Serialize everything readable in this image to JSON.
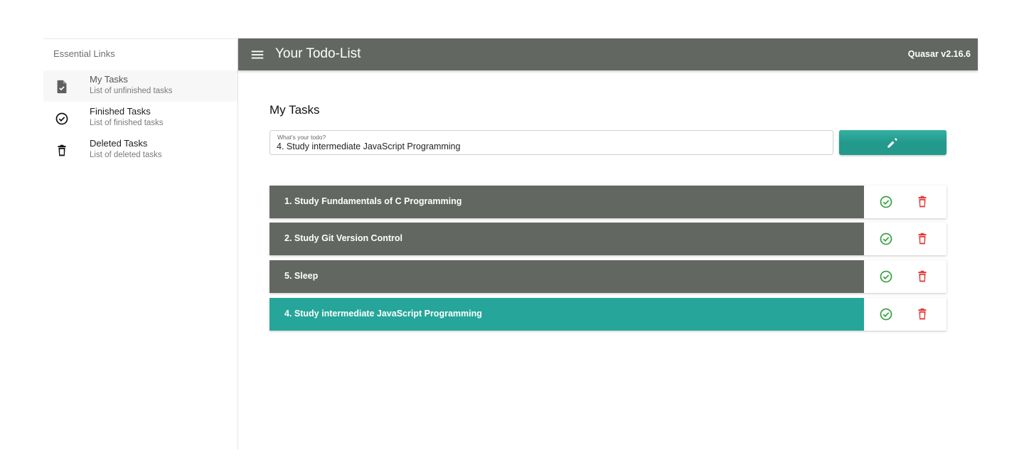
{
  "drawer": {
    "header": "Essential Links",
    "items": [
      {
        "title": "My Tasks",
        "caption": "List of unfinished tasks",
        "icon": "task-doc-icon"
      },
      {
        "title": "Finished Tasks",
        "caption": "List of finished tasks",
        "icon": "check-circle-icon"
      },
      {
        "title": "Deleted Tasks",
        "caption": "List of deleted tasks",
        "icon": "trash-icon"
      }
    ]
  },
  "header": {
    "title": "Your Todo-List",
    "version": "Quasar v2.16.6",
    "menu_icon": "menu-icon"
  },
  "main": {
    "title": "My Tasks",
    "input": {
      "label": "What's your todo?",
      "value": "4. Study intermediate JavaScript Programming"
    },
    "save_icon": "pencil-icon"
  },
  "tasks": [
    {
      "text": "1. Study Fundamentals of C Programming"
    },
    {
      "text": "2. Study Git Version Control"
    },
    {
      "text": "5. Sleep"
    },
    {
      "text": "4. Study intermediate JavaScript Programming",
      "selected": true
    }
  ],
  "colors": {
    "header": "#636762",
    "task": "#636762",
    "selected_task": "#26a69a",
    "finish": "#3aa040",
    "delete": "#e53935"
  }
}
